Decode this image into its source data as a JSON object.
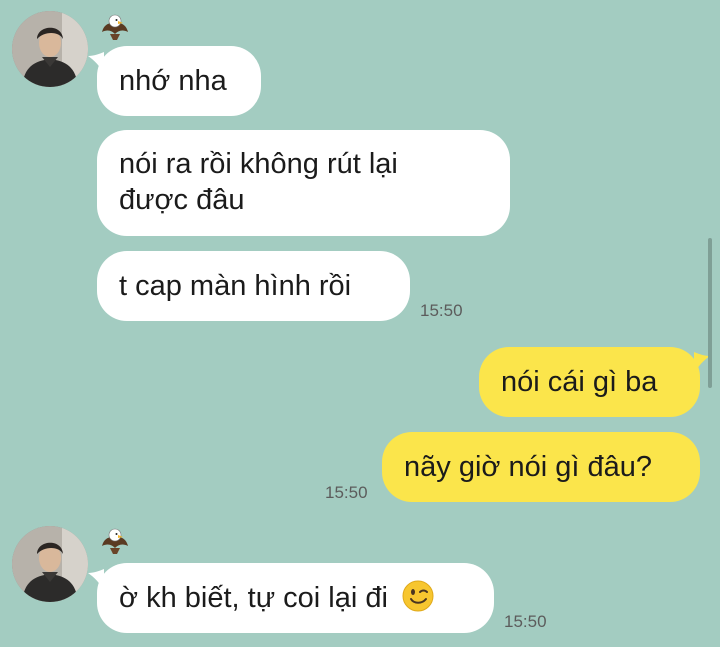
{
  "chat": {
    "messages": [
      {
        "side": "in",
        "text": "nhớ nha"
      },
      {
        "side": "in",
        "line1": "nói ra rồi không rút lại",
        "line2": "được đâu"
      },
      {
        "side": "in",
        "text": "t cap màn hình rồi",
        "time": "15:50"
      },
      {
        "side": "out",
        "text": "nói cái gì ba"
      },
      {
        "side": "out",
        "text": "nãy giờ nói gì đâu?",
        "time": "15:50"
      },
      {
        "side": "in",
        "text": "ờ kh biết, tự coi lại đi",
        "emoji": "wink-emoji",
        "time": "15:50"
      }
    ]
  },
  "icons": {
    "avatar": "contact-avatar",
    "sticker": "eagle-sticker-icon"
  },
  "colors": {
    "background": "#a3ccc1",
    "incoming_bubble": "#ffffff",
    "outgoing_bubble": "#fbe54b",
    "timestamp": "#5c5c5c"
  }
}
